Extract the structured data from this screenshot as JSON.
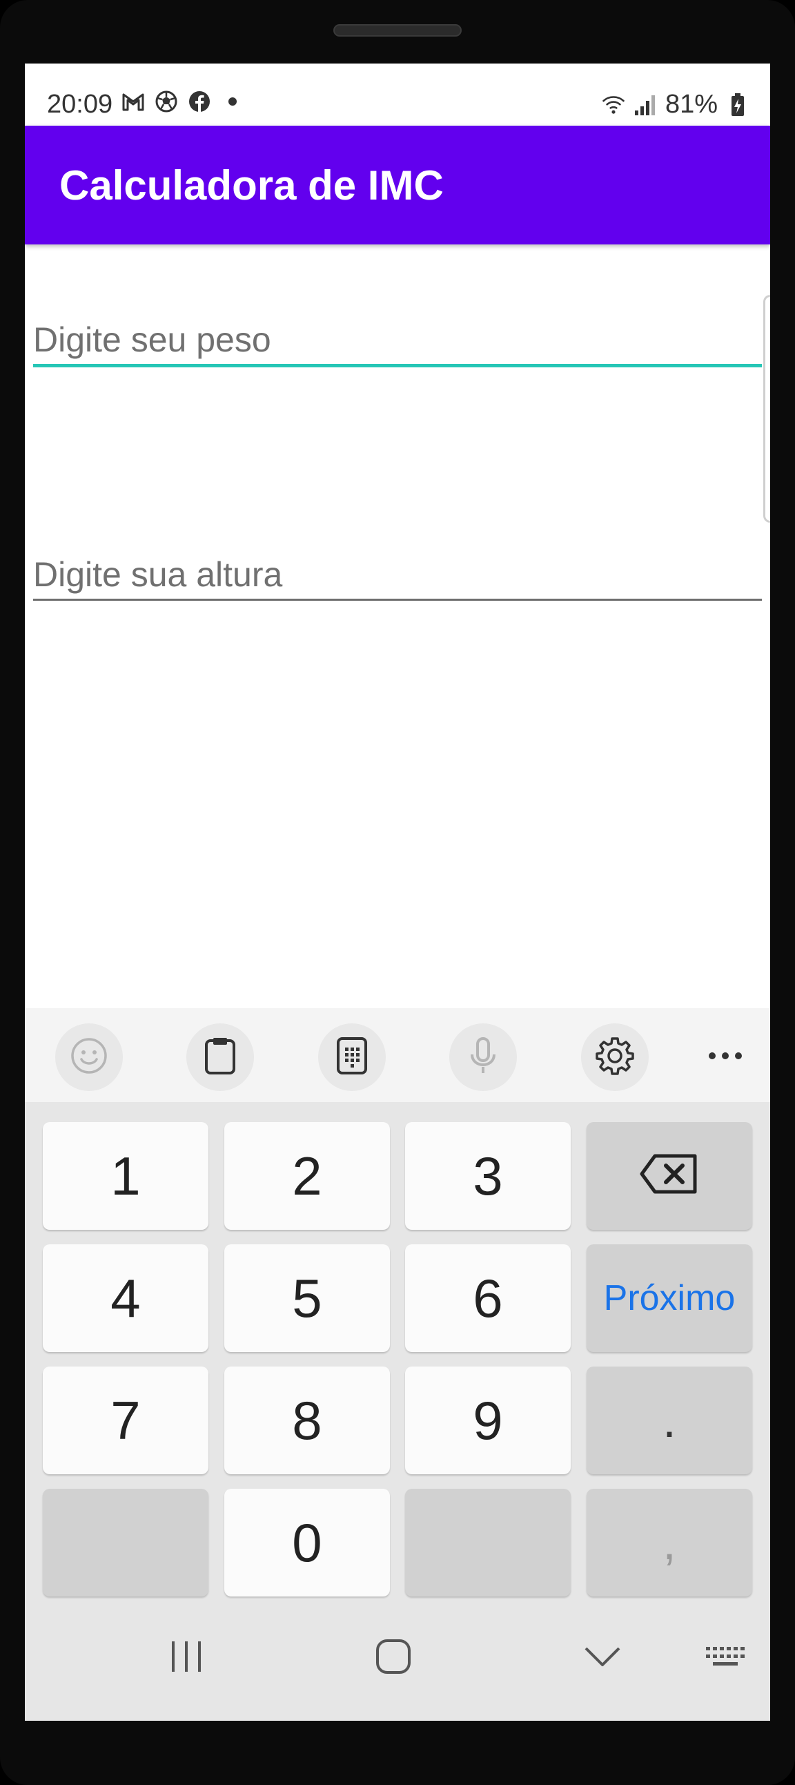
{
  "status_bar": {
    "time": "20:09",
    "battery": "81%",
    "left_icons": [
      "gmail-icon",
      "soccer-ball-icon",
      "facebook-icon",
      "dot-icon"
    ],
    "right_icons": [
      "wifi-icon",
      "signal-icon",
      "battery-icon"
    ]
  },
  "app_bar": {
    "title": "Calculadora de IMC",
    "color": "#6200ee"
  },
  "form": {
    "weight_placeholder": "Digite seu peso",
    "weight_value": "",
    "height_placeholder": "Digite sua altura",
    "height_value": "",
    "focus_color": "#26c6b6"
  },
  "keyboard": {
    "toolbar": [
      "emoji-icon",
      "clipboard-icon",
      "keypad-icon",
      "microphone-icon",
      "settings-icon",
      "more-icon"
    ],
    "keys": {
      "k1": "1",
      "k2": "2",
      "k3": "3",
      "k4": "4",
      "k5": "5",
      "k6": "6",
      "k7": "7",
      "k8": "8",
      "k9": "9",
      "k0": "0",
      "next": "Próximo",
      "period": ".",
      "comma": ","
    },
    "accent_color": "#1a73e8"
  },
  "nav_bar": [
    "recent-apps-icon",
    "home-icon",
    "hide-keyboard-icon",
    "keyboard-icon"
  ]
}
